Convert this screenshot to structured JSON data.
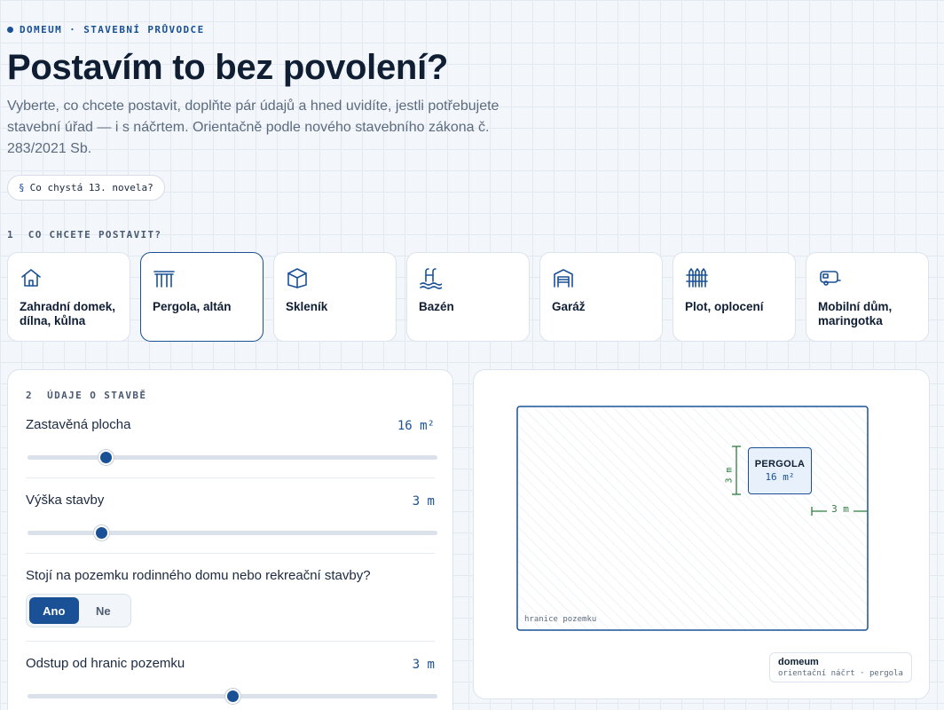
{
  "header": {
    "eyebrow": "DOMEUM · STAVEBNÍ PRŮVODCE",
    "title": "Postavím to bez povolení?",
    "lead": "Vyberte, co chcete postavit, doplňte pár údajů a hned uvidíte, jestli potřebujete stavební úřad — i s náčrtem. Orientačně podle nového stavebního zákona č. 283/2021 Sb.",
    "chip_symbol": "§",
    "chip_label": "Co chystá 13. novela?"
  },
  "step1": {
    "label": "1  CO CHCETE POSTAVIT?",
    "selected_index": 1,
    "types": [
      {
        "label": "Zahradní domek, dílna, kůlna",
        "icon": "house-icon"
      },
      {
        "label": "Pergola, altán",
        "icon": "pergola-icon"
      },
      {
        "label": "Skleník",
        "icon": "greenhouse-icon"
      },
      {
        "label": "Bazén",
        "icon": "pool-icon"
      },
      {
        "label": "Garáž",
        "icon": "garage-icon"
      },
      {
        "label": "Plot, oplocení",
        "icon": "fence-icon"
      },
      {
        "label": "Mobilní dům, maringotka",
        "icon": "caravan-icon"
      }
    ]
  },
  "step2": {
    "label": "2  ÚDAJE O STAVBĚ",
    "area": {
      "label": "Zastavěná plocha",
      "value": "16 m²",
      "fraction": 0.19
    },
    "height": {
      "label": "Výška stavby",
      "value": "3 m",
      "fraction": 0.18
    },
    "question": {
      "label": "Stojí na pozemku rodinného domu nebo rekreační stavby?",
      "yes": "Ano",
      "no": "Ne",
      "selected": "yes"
    },
    "offset": {
      "label": "Odstup od hranic pozemku",
      "value": "3 m",
      "fraction": 0.5
    }
  },
  "sketch": {
    "boundary_caption": "hranice pozemku",
    "structure_name": "PERGOLA",
    "structure_area": "16 m²",
    "height_dim": "3 m",
    "offset_dim": "3 m",
    "legend_brand": "domeum",
    "legend_sub": "orientační náčrt · pergola"
  },
  "colors": {
    "accent": "#1a5196",
    "dimension": "#2e7d3e",
    "text": "#0f1e33",
    "muted": "#5c6b7f"
  }
}
